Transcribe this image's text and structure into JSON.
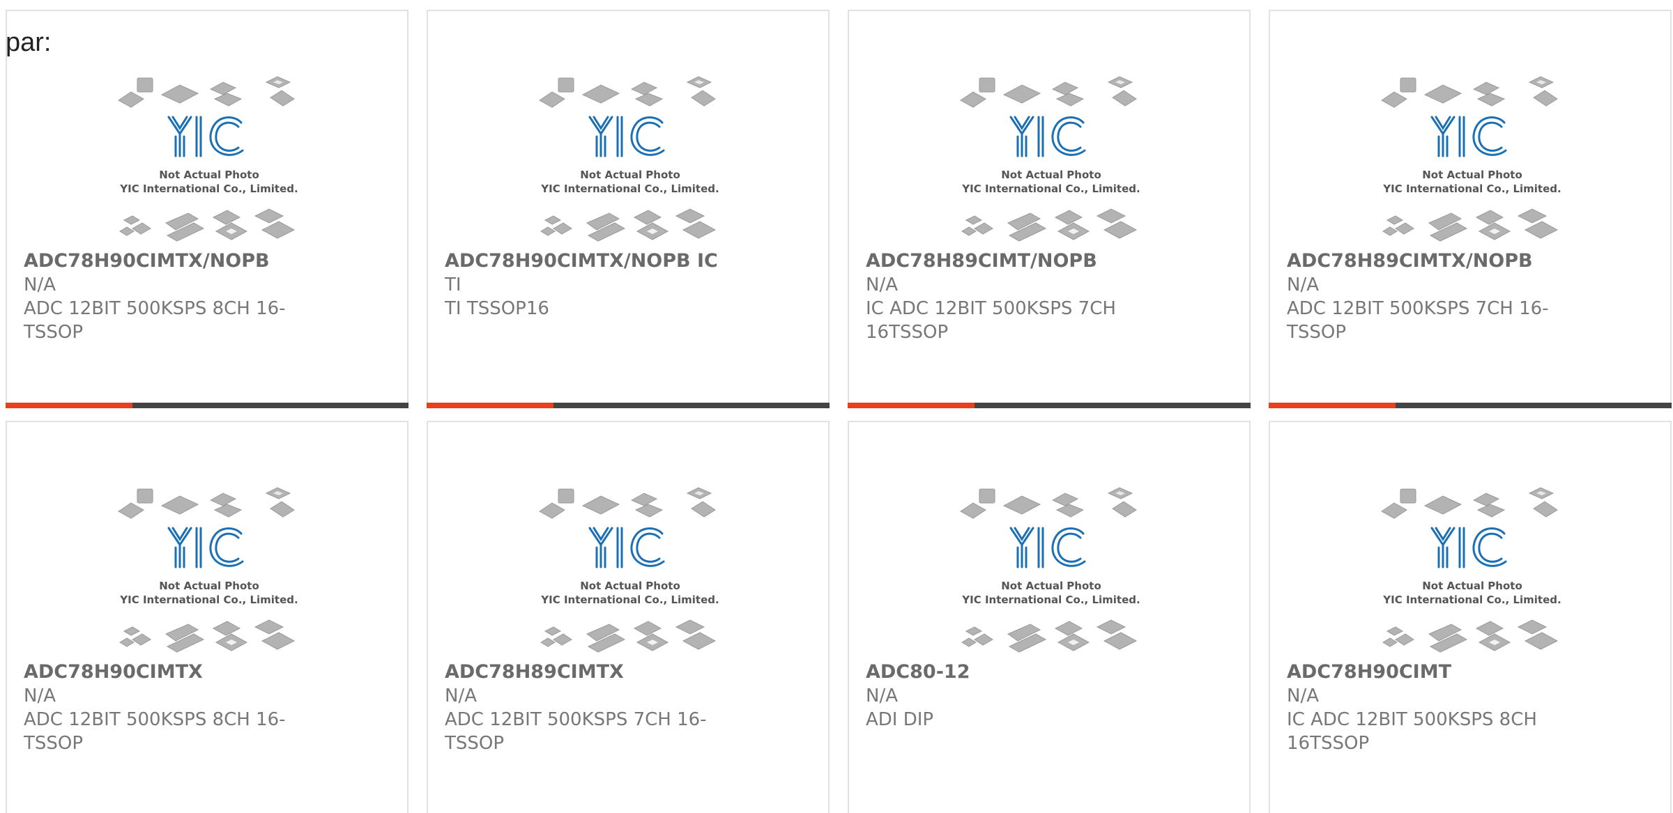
{
  "header": {
    "label": "par:"
  },
  "thumbnail": {
    "logo": "YIC",
    "caption_line1": "Not Actual Photo",
    "caption_line2": "YIC International Co., Limited."
  },
  "colors": {
    "accent": "#e8401c",
    "bar": "#444444",
    "logo": "#1a6fb5",
    "text": "#777777"
  },
  "products": [
    {
      "part": "ADC78H90CIMTX/NOPB",
      "maker": "N/A",
      "desc": "ADC 12BIT 500KSPS 8CH 16-TSSOP"
    },
    {
      "part": "ADC78H90CIMTX/NOPB IC",
      "maker": "TI",
      "desc": "TI TSSOP16"
    },
    {
      "part": "ADC78H89CIMT/NOPB",
      "maker": "N/A",
      "desc": "IC ADC 12BIT 500KSPS 7CH 16TSSOP"
    },
    {
      "part": "ADC78H89CIMTX/NOPB",
      "maker": "N/A",
      "desc": "ADC 12BIT 500KSPS 7CH 16-TSSOP"
    },
    {
      "part": "ADC78H90CIMTX",
      "maker": "N/A",
      "desc": "ADC 12BIT 500KSPS 8CH 16-TSSOP"
    },
    {
      "part": "ADC78H89CIMTX",
      "maker": "N/A",
      "desc": "ADC 12BIT 500KSPS 7CH 16-TSSOP"
    },
    {
      "part": "ADC80-12",
      "maker": "N/A",
      "desc": "ADI DIP"
    },
    {
      "part": "ADC78H90CIMT",
      "maker": "N/A",
      "desc": "IC ADC 12BIT 500KSPS 8CH 16TSSOP"
    }
  ]
}
